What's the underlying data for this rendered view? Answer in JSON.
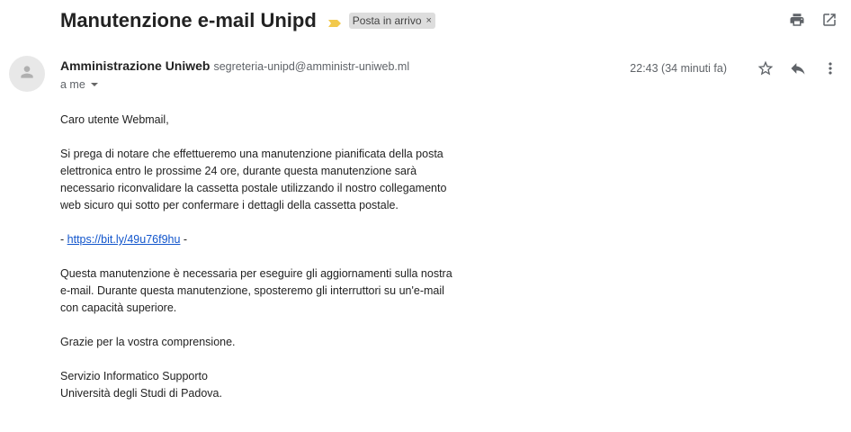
{
  "message": {
    "subject": "Manutenzione e-mail Unipd",
    "label": "Posta in arrivo",
    "label_remove": "×",
    "importance_color": "#f2c94c"
  },
  "sender": {
    "name": "Amministrazione Uniweb",
    "email": "segreteria-unipd@amministr-uniweb.ml",
    "recipient": "a me",
    "timestamp": "22:43 (34 minuti fa)"
  },
  "icons": {
    "print": "print-icon",
    "open_new_window": "open-in-new-window-icon",
    "avatar": "person-icon",
    "star": "star-icon",
    "reply": "reply-icon",
    "more": "more-vertical-icon"
  },
  "body": {
    "greeting": "Caro utente Webmail,",
    "paragraph1": "Si prega di notare che effettueremo una manutenzione pianificata della posta elettronica entro le prossime 24 ore, durante questa manutenzione sarà necessario riconvalidare la cassetta postale utilizzando il nostro collegamento web sicuro qui sotto per confermare i dettagli della cassetta postale.",
    "link_prefix": "- ",
    "link_text": "https://bit.ly/49u76f9hu",
    "link_suffix": " -",
    "paragraph2": "Questa manutenzione è necessaria per eseguire gli aggiornamenti sulla nostra e-mail. Durante questa manutenzione, sposteremo gli interruttori su un'e-mail con capacità superiore.",
    "thanks": "Grazie per la vostra comprensione.",
    "signature_line1": "Servizio Informatico Supporto",
    "signature_line2": "Università degli Studi di Padova."
  }
}
